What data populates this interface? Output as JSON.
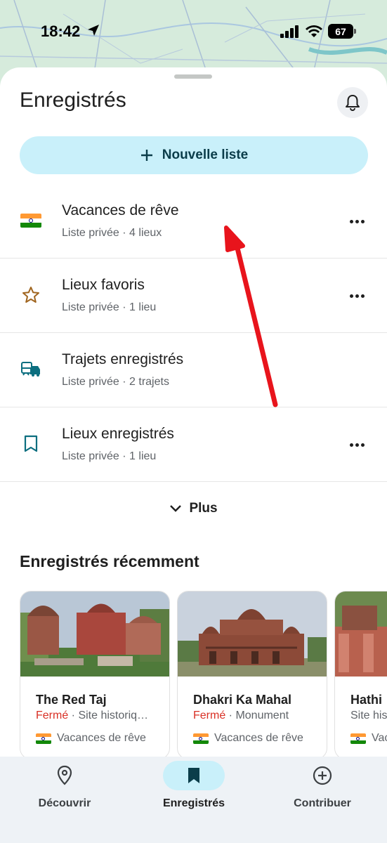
{
  "status_bar": {
    "time": "18:42",
    "battery": "67"
  },
  "header": {
    "title": "Enregistrés"
  },
  "new_list": {
    "label": "Nouvelle liste"
  },
  "lists": [
    {
      "name": "Vacances de rêve",
      "sub": "Liste privée · 4 lieux",
      "icon": "india-flag-icon"
    },
    {
      "name": "Lieux favoris",
      "sub": "Liste privée · 1 lieu",
      "icon": "star-icon"
    },
    {
      "name": "Trajets enregistrés",
      "sub": "Liste privée · 2 trajets",
      "icon": "commute-icon"
    },
    {
      "name": "Lieux enregistrés",
      "sub": "Liste privée · 1 lieu",
      "icon": "bookmark-icon"
    }
  ],
  "more": {
    "label": "Plus"
  },
  "recent": {
    "title": "Enregistrés récemment",
    "cards": [
      {
        "name": "The Red Taj",
        "status": "Fermé",
        "category": " · Site historiq…",
        "list": "Vacances de rêve"
      },
      {
        "name": "Dhakri Ka Mahal",
        "status": "Fermé",
        "category": " · Monument",
        "list": "Vacances de rêve"
      },
      {
        "name": "Hathi",
        "status": "",
        "category": "Site his",
        "list": "Vac"
      }
    ]
  },
  "nav": [
    {
      "label": "Découvrir",
      "icon": "location-pin-icon"
    },
    {
      "label": "Enregistrés",
      "icon": "bookmark-icon",
      "active": true
    },
    {
      "label": "Contribuer",
      "icon": "add-circle-icon"
    }
  ],
  "colors": {
    "accent": "#c9f0fa",
    "closed": "#d93025",
    "annotation": "#e8141c"
  }
}
